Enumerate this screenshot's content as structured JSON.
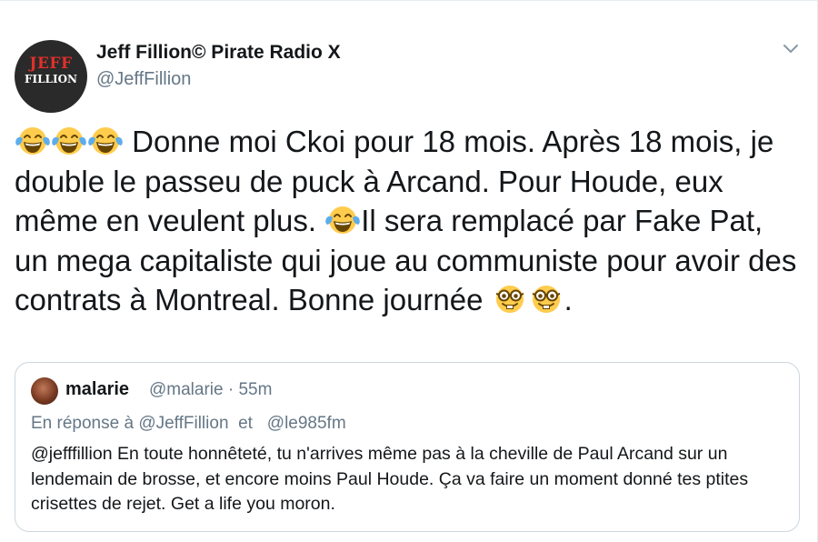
{
  "author": {
    "avatar_line1": "JEFF",
    "avatar_line2": "FILLION",
    "name": "Jeff Fillion© Pirate Radio X",
    "handle": "@JeffFillion"
  },
  "tweet": {
    "segment1": " Donne moi Ckoi pour 18 mois. Après 18 mois, je double le passeu de puck à Arcand. Pour Houde, eux même en veulent plus. ",
    "segment2": "Il sera remplacé par Fake Pat, un mega capitaliste qui joue au communiste pour avoir des contrats à Montreal. Bonne journée ",
    "segment3": ".",
    "emoji_names": [
      "face-with-tears-of-joy-icon",
      "nerd-face-icon"
    ]
  },
  "quoted_tweet": {
    "name": "malarie",
    "meta": "@malarie · 55m",
    "reply_prefix": "En réponse à ",
    "reply_user1": "@JeffFillion",
    "reply_and": "et",
    "reply_user2": "@le985fm",
    "body": "@jefffillion  En toute honnêteté, tu n'arrives même pas à la cheville de Paul Arcand sur un lendemain de brosse, et encore moins Paul Houde.  Ça va faire un moment donné tes ptites crisettes de rejet. Get a life you moron."
  },
  "colors": {
    "text": "#14171a",
    "secondary": "#657786",
    "border": "#ccd6dd",
    "avatar_red": "#e0302a"
  }
}
